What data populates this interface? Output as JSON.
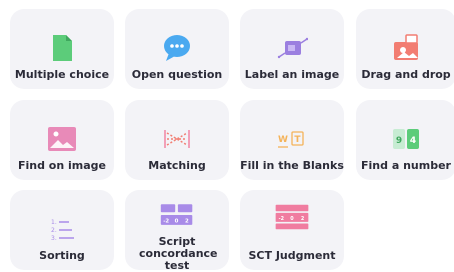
{
  "question_types": [
    {
      "label": "Multiple choice",
      "icon": "multiple-choice-icon"
    },
    {
      "label": "Open question",
      "icon": "open-question-icon"
    },
    {
      "label": "Label an image",
      "icon": "label-image-icon"
    },
    {
      "label": "Drag and drop",
      "icon": "drag-and-drop-icon"
    },
    {
      "label": "Find on image",
      "icon": "find-on-image-icon"
    },
    {
      "label": "Matching",
      "icon": "matching-icon"
    },
    {
      "label": "Fill in the Blanks",
      "icon": "fill-in-the-blanks-icon"
    },
    {
      "label": "Find a number",
      "icon": "find-a-number-icon"
    },
    {
      "label": "Sorting",
      "icon": "sorting-icon"
    },
    {
      "label": "Script concordance test",
      "icon": "script-concordance-icon"
    },
    {
      "label": "SCT Judgment",
      "icon": "sct-judgment-icon"
    }
  ],
  "icon_text": {
    "sorting_numbers": [
      "1.",
      "2.",
      "3."
    ],
    "fill_blank_letters": [
      "W",
      "T"
    ],
    "find_number_digits": [
      "9",
      "4"
    ],
    "sct_scale": [
      "-2",
      "0",
      "2"
    ],
    "sct_judgment_scale": [
      "-2",
      "0",
      "2"
    ]
  },
  "colors": {
    "card_background": "#f3f3f7",
    "label_text": "#2b2b38",
    "green": "#5ccc7a",
    "blue": "#4aa9f0",
    "purple": "#9b7fe0",
    "coral": "#f27d72",
    "pink": "#e88ab8",
    "orange": "#f4b35a",
    "violet": "#a88be8",
    "rose": "#f07ca0"
  }
}
